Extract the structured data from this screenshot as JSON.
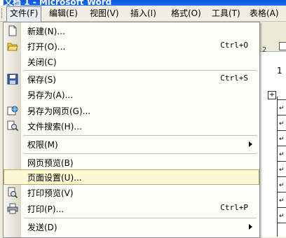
{
  "window": {
    "title": "文档 1 - Microsoft Word"
  },
  "menubar": {
    "items": [
      {
        "label": "文件(F)"
      },
      {
        "label": "编辑(E)"
      },
      {
        "label": "视图(V)"
      },
      {
        "label": "插入(I)"
      },
      {
        "label": "格式(O)"
      },
      {
        "label": "工具(T)"
      },
      {
        "label": "表格(A)"
      }
    ]
  },
  "file_menu": {
    "items": [
      {
        "label": "新建(N)...",
        "shortcut": "",
        "icon": "new-document-icon"
      },
      {
        "label": "打开(O)...",
        "shortcut": "Ctrl+O",
        "icon": "open-folder-icon"
      },
      {
        "label": "关闭(C)",
        "shortcut": "",
        "icon": ""
      },
      {
        "label": "保存(S)",
        "shortcut": "Ctrl+S",
        "icon": "save-disk-icon"
      },
      {
        "label": "另存为(A)...",
        "shortcut": "",
        "icon": ""
      },
      {
        "label": "另存为网页(G)...",
        "shortcut": "",
        "icon": "save-as-web-icon"
      },
      {
        "label": "文件搜索(H)...",
        "shortcut": "",
        "icon": "file-search-icon"
      },
      {
        "label": "权限(M)",
        "shortcut": "",
        "icon": "",
        "submenu": true
      },
      {
        "label": "网页预览(B)",
        "shortcut": "",
        "icon": ""
      },
      {
        "label": "页面设置(U)...",
        "shortcut": "",
        "icon": "",
        "highlighted": true
      },
      {
        "label": "打印预览(V)",
        "shortcut": "",
        "icon": "print-preview-icon"
      },
      {
        "label": "打印(P)...",
        "shortcut": "Ctrl+P",
        "icon": "printer-icon"
      },
      {
        "label": "发送(D)",
        "shortcut": "",
        "icon": "",
        "submenu": true
      }
    ]
  },
  "document": {
    "ruler_text": "2",
    "body_text": "1"
  },
  "colors": {
    "highlight": "#fef8d2",
    "titlebar": "#0a57d9"
  }
}
